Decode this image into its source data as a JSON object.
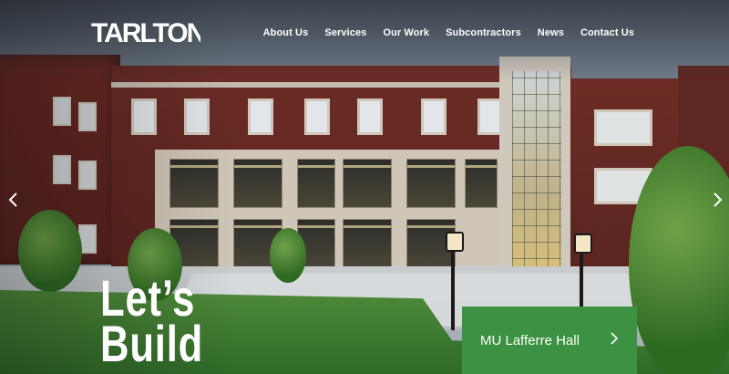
{
  "brand": {
    "logo_text": "TARLTON"
  },
  "nav": {
    "items": [
      {
        "label": "About Us"
      },
      {
        "label": "Services"
      },
      {
        "label": "Our Work"
      },
      {
        "label": "Subcontractors"
      },
      {
        "label": "News"
      },
      {
        "label": "Contact Us"
      }
    ]
  },
  "hero": {
    "title_line1": "Let’s",
    "title_line2": "Build"
  },
  "carousel": {
    "prev_icon": "chevron-left-icon",
    "next_icon": "chevron-right-icon"
  },
  "project_card": {
    "label": "MU Lafferre Hall",
    "icon": "chevron-right-icon",
    "color": "#3c9142"
  }
}
